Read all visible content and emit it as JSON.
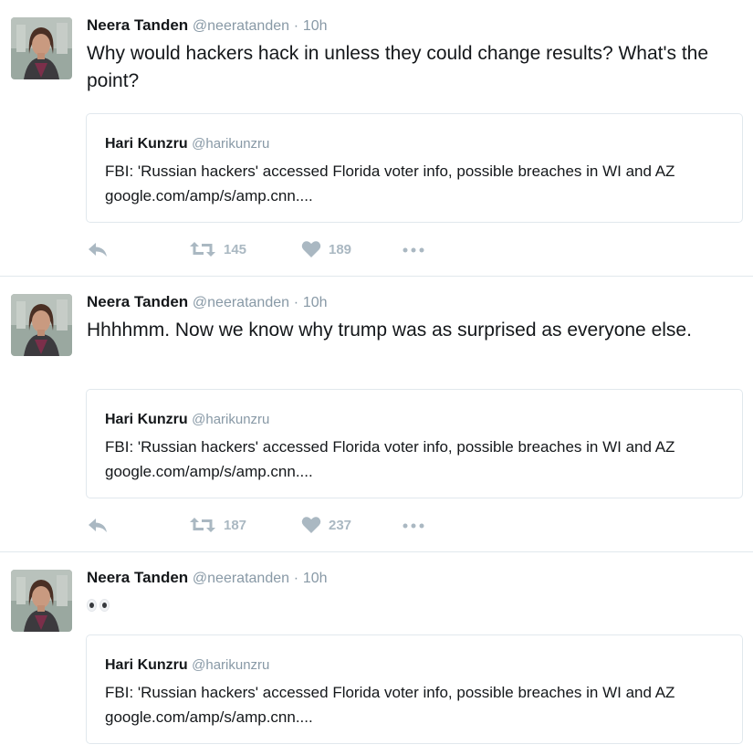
{
  "tweets": [
    {
      "name": "Neera Tanden",
      "handle": "@neeratanden",
      "separator": "·",
      "time": "10h",
      "text": "Why would hackers hack in unless they could change results? What's the point?",
      "quote": {
        "name": "Hari Kunzru",
        "handle": "@harikunzru",
        "text": "FBI: 'Russian hackers' accessed Florida voter info, possible breaches in WI and AZ  google.com/amp/s/amp.cnn...."
      },
      "retweets": "145",
      "likes": "189"
    },
    {
      "name": "Neera Tanden",
      "handle": "@neeratanden",
      "separator": "·",
      "time": "10h",
      "text": "Hhhhmm. Now we know why trump was as surprised as everyone else.",
      "quote": {
        "name": "Hari Kunzru",
        "handle": "@harikunzru",
        "text": "FBI: 'Russian hackers' accessed Florida voter info, possible breaches in WI and AZ  google.com/amp/s/amp.cnn...."
      },
      "retweets": "187",
      "likes": "237"
    },
    {
      "name": "Neera Tanden",
      "handle": "@neeratanden",
      "separator": "·",
      "time": "10h",
      "emoji_icon": "eyes-emoji",
      "quote": {
        "name": "Hari Kunzru",
        "handle": "@harikunzru",
        "text": "FBI: 'Russian hackers' accessed Florida voter info, possible breaches in WI and AZ  google.com/amp/s/amp.cnn...."
      }
    }
  ],
  "colors": {
    "text": "#14171a",
    "muted": "#8899a6",
    "icon": "#aab8c2",
    "border": "#e1e8ed"
  },
  "icons": [
    "reply-icon",
    "retweet-icon",
    "like-icon",
    "more-icon"
  ]
}
